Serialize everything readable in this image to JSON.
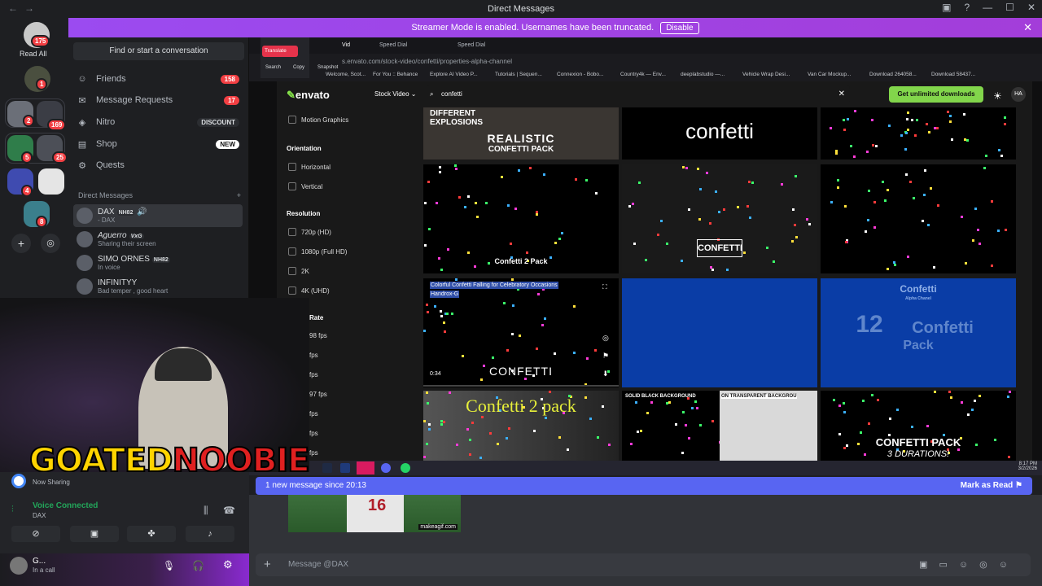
{
  "window": {
    "title": "Direct Messages"
  },
  "banner": {
    "text": "Streamer Mode is enabled. Usernames have been truncated.",
    "button": "Disable"
  },
  "servers": {
    "read_all": "Read All",
    "home_badge": "175",
    "badges": [
      "1",
      "2",
      "169",
      "5",
      "25",
      "4",
      "8"
    ]
  },
  "dm_panel": {
    "search_placeholder": "Find or start a conversation",
    "nav": [
      {
        "label": "Friends",
        "badge": "158",
        "icon": "friends-icon"
      },
      {
        "label": "Message Requests",
        "badge": "17",
        "icon": "mail-icon"
      },
      {
        "label": "Nitro",
        "badge": "DISCOUNT",
        "icon": "nitro-icon"
      },
      {
        "label": "Shop",
        "badge": "NEW",
        "icon": "shop-icon"
      },
      {
        "label": "Quests",
        "badge": "",
        "icon": "quests-icon"
      }
    ],
    "dm_header": "Direct Messages",
    "dms": [
      {
        "name": "DAX",
        "tag": "NH82",
        "status": "- DAX"
      },
      {
        "name": "Aguerro",
        "tag": "VxG",
        "status": "Sharing their screen"
      },
      {
        "name": "SIMO ORNES",
        "tag": "NH82",
        "status": "In voice"
      },
      {
        "name": "INFINITYY",
        "tag": "",
        "status": "Bad temper , good heart"
      }
    ]
  },
  "browser": {
    "tabs": [
      "Speed Dial",
      "Speed Dial"
    ],
    "tab_active": "Vid",
    "url": "s.envato.com/stock-video/confetti/properties-alpha-channel",
    "extension": {
      "button": "Translate",
      "items": [
        "Search",
        "Copy",
        "Snapshot"
      ]
    },
    "bookmarks": [
      "Welcome, Scot...",
      "For You :: Behance",
      "Explore AI Video P...",
      "Tutorials | Sequen...",
      "Connexion - Bobo...",
      "Country4k — Env...",
      "deeplabstudio —...",
      "Vehicle Wrap Desi...",
      "Van Car Mockup...",
      "Download 264058...",
      "Download 58437..."
    ]
  },
  "envato": {
    "logo": "envato",
    "category": "Stock Video",
    "query": "confetti",
    "cta": "Get unlimited downloads",
    "avatar": "HA",
    "filters": {
      "motion": "Motion Graphics",
      "orientation_title": "Orientation",
      "orientation": [
        "Horizontal",
        "Vertical"
      ],
      "resolution_title": "Resolution",
      "resolution": [
        "720p (HD)",
        "1080p (Full HD)",
        "2K",
        "4K (UHD)"
      ],
      "framerate_title": "Rate",
      "framerates": [
        "98 fps",
        "fps",
        "fps",
        "97 fps",
        "fps",
        "fps",
        "fps"
      ]
    },
    "tiles": {
      "t1a": "DIFFERENT",
      "t1b": "EXPLOSIONS",
      "t1c": "REALISTIC",
      "t1d": "CONFETTI PACK",
      "t2": "confetti",
      "t4": "Confetti 2 Pack",
      "t5": "CONFETTI",
      "t7_title": "Colorful Confetti Falling for Celebratory Occasions",
      "t7_author": "Handrox-G",
      "t7_word": "CONFETTI",
      "t7_time": "0:34",
      "t9a": "Confetti",
      "t9b": "12",
      "t9c": "Pack",
      "t9d": "Alpha Chanel",
      "t10": "Confetti 2 pack",
      "t11a": "SOLID BLACK BACKGROUND",
      "t11b": "ON TRANSPARENT BACKGROU",
      "t12a": "CONFETTI PACK",
      "t12b": "3 DURATIONS!"
    }
  },
  "taskbar": {
    "time": "8:17 PM",
    "date": "3/2/2026"
  },
  "new_message": {
    "text": "1 new message since 20:13",
    "action": "Mark as Read"
  },
  "gif_watermark": "makeagif.com",
  "jersey_number": "16",
  "voice": {
    "status": "Voice Connected",
    "channel": "DAX",
    "sharing": "Now Sharing"
  },
  "user": {
    "name": "G...",
    "status": "In a call"
  },
  "message_placeholder": "Message @DAX",
  "overlay": {
    "part1": "GOATED",
    "part2": "NOOBIE"
  },
  "colors": {
    "accent": "#5865f2",
    "banner": "#9b4bf0",
    "envato_green": "#82d64b",
    "danger": "#f23f43",
    "voice_green": "#23a55a"
  }
}
